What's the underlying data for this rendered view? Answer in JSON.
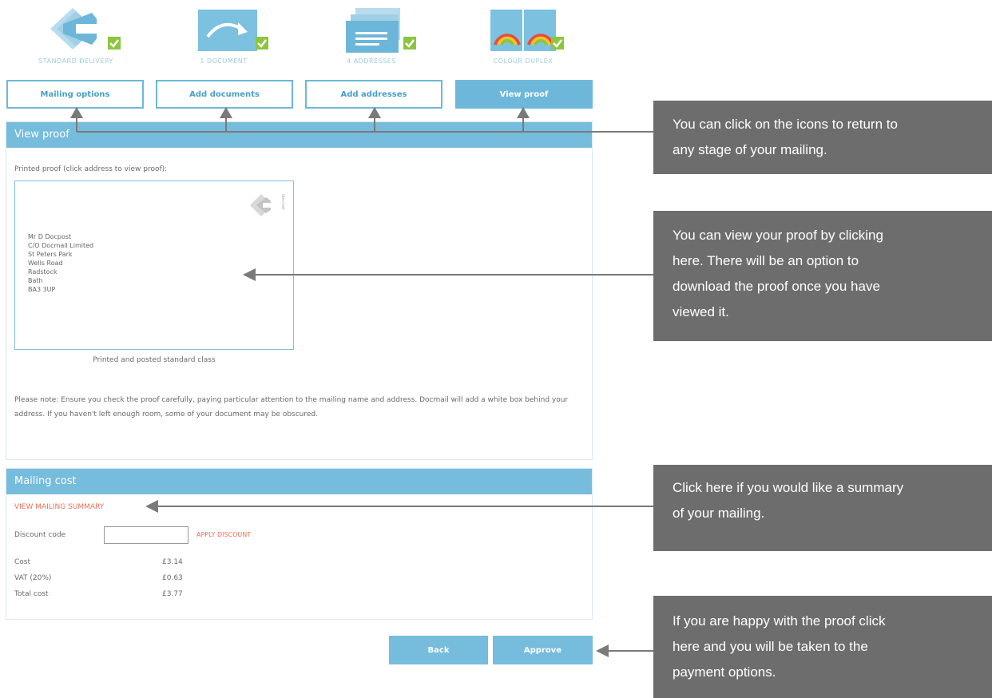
{
  "steps": [
    {
      "caption": "STANDARD DELIVERY",
      "button": "Mailing options",
      "icon": "envelope-delivery-icon"
    },
    {
      "caption": "1 DOCUMENT",
      "button": "Add documents",
      "icon": "document-icon"
    },
    {
      "caption": "4 ADDRESSES",
      "button": "Add addresses",
      "icon": "address-list-icon"
    },
    {
      "caption": "COLOUR DUPLEX",
      "button": "View proof",
      "icon": "colour-rainbow-icon"
    }
  ],
  "view_proof": {
    "title": "View proof",
    "instruction": "Printed proof (click address to view proof):",
    "address_lines": [
      "Mr D Docpost",
      "C/O Docmail Limited",
      "St Peters Park",
      "Wells Road",
      "Radstock",
      "Bath",
      "BA3 3UP"
    ],
    "stamp_text": "docmail",
    "class_caption": "Printed and posted standard class",
    "note": "Please note: Ensure you check the proof carefully, paying particular attention to the mailing name and address. Docmail will add a white box behind your address. If you haven't left enough room, some of your document may be obscured."
  },
  "mailing_cost": {
    "title": "Mailing cost",
    "summary_link": "VIEW MAILING SUMMARY",
    "discount_label": "Discount code",
    "discount_value": "",
    "apply_label": "APPLY DISCOUNT",
    "rows": [
      {
        "label": "Cost",
        "value": "£3.14"
      },
      {
        "label": "VAT (20%)",
        "value": "£0.63"
      },
      {
        "label": "Total cost",
        "value": "£3.77"
      }
    ]
  },
  "actions": {
    "back": "Back",
    "approve": "Approve"
  },
  "callouts": {
    "icons": [
      "You can click on the icons to return to",
      "any stage of your mailing."
    ],
    "proof": [
      "You can view your proof by clicking",
      "here. There will be an option to",
      "download the proof once you have",
      "viewed it."
    ],
    "summary": [
      "Click here if you would like a summary",
      "of your mailing."
    ],
    "approve": [
      "If you are happy with the proof click",
      "here and you will be taken to the",
      "payment options."
    ]
  },
  "colors": {
    "accent": "#76bcdc",
    "link": "#f0705a",
    "callout": "#6d6d6d",
    "check": "#8cc63f"
  }
}
